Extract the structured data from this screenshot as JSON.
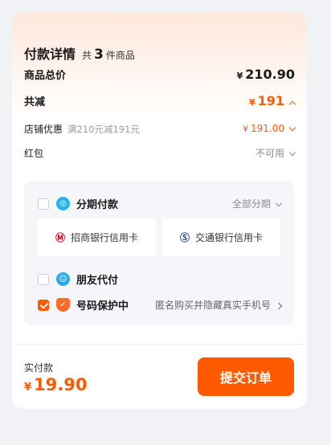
{
  "header": {
    "title": "付款详情",
    "count_prefix": "共",
    "count": "3",
    "count_suffix": "件商品"
  },
  "rows": {
    "total": {
      "label": "商品总价",
      "currency": "¥",
      "value": "210.90"
    },
    "discount": {
      "label": "共减",
      "currency": "¥",
      "value": "191"
    },
    "store_coupon": {
      "label": "店铺优惠",
      "note": "满210元减191元",
      "currency": "¥",
      "value": "191.00"
    },
    "red_packet": {
      "label": "红包",
      "value": "不可用"
    }
  },
  "options": {
    "installment": {
      "label": "分期付款",
      "right": "全部分期",
      "checked": false,
      "icon": "installment-icon"
    },
    "banks": [
      {
        "name": "招商银行信用卡",
        "icon": "cmb-bank-logo"
      },
      {
        "name": "交通银行信用卡",
        "icon": "bocom-bank-logo"
      }
    ],
    "friend_pay": {
      "label": "朋友代付",
      "checked": false,
      "icon": "friend-pay-icon"
    },
    "number_protect": {
      "label": "号码保护中",
      "right": "匿名购买并隐藏真实手机号",
      "checked": true,
      "icon": "shield-icon"
    }
  },
  "footer": {
    "pay_label": "实付款",
    "currency": "¥",
    "pay_value": "19.90",
    "submit_label": "提交订单"
  },
  "colors": {
    "accent": "#ff5a00",
    "background": "#f1f2f6",
    "panel": "#f4f6f9"
  }
}
